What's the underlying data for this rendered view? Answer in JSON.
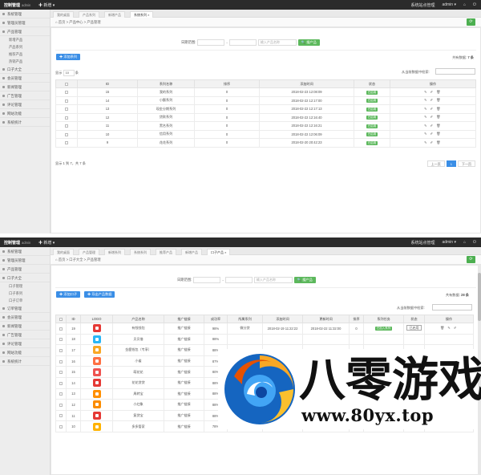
{
  "brand": {
    "name": "控制管理",
    "sub": "admin"
  },
  "topbar": {
    "new_label": "✚ 新增 ▾",
    "site_label": "系统站点管理",
    "user_label": "admin ▾",
    "home_icon": "home-icon",
    "logout_icon": "power-icon"
  },
  "panel1": {
    "sidebar": {
      "items": [
        {
          "label": "系统管理",
          "type": "group"
        },
        {
          "label": "管理员管理",
          "type": "group"
        },
        {
          "label": "产品管理",
          "type": "group"
        },
        {
          "label": "新增产品",
          "type": "sub"
        },
        {
          "label": "产品系列",
          "type": "sub"
        },
        {
          "label": "推荐产品",
          "type": "sub"
        },
        {
          "label": "热销产品",
          "type": "sub"
        },
        {
          "label": "口子大全",
          "type": "group"
        },
        {
          "label": "会员管理",
          "type": "group"
        },
        {
          "label": "新闻管理",
          "type": "group"
        },
        {
          "label": "广告管理",
          "type": "group"
        },
        {
          "label": "评论管理",
          "type": "group"
        },
        {
          "label": "网站功能",
          "type": "group"
        },
        {
          "label": "系统统计",
          "type": "group"
        }
      ]
    },
    "tabs": [
      "我的桌面",
      "产品系列",
      "新增产品",
      "系统系列 ×"
    ],
    "breadcrumb": "⌂ 首页 > 产品中心 > 产品管理",
    "filter": {
      "date_label": "日期范围:",
      "date_placeholder": "",
      "sep": "-",
      "keyword_placeholder": "输入产品名称",
      "search_btn": "🔍 搜产品"
    },
    "add_btn": "✚ 添加系列",
    "count_label": "共有数据:",
    "count_value": "7 条",
    "show_label": "显示",
    "show_value": "10",
    "entries_label": "条",
    "search_label": "从当前数据中检索:",
    "columns": [
      "",
      "ID",
      "系列名称",
      "排序",
      "添加时间",
      "状态",
      "操作"
    ],
    "rows": [
      {
        "id": "15",
        "name": "我的系列",
        "sort": "0",
        "time": "2018-02-23 12:08:09",
        "status": "已启用"
      },
      {
        "id": "14",
        "name": "小额系列",
        "sort": "0",
        "time": "2018-02-22 12:17:00",
        "status": "已启用"
      },
      {
        "id": "13",
        "name": "现金分期系列",
        "sort": "0",
        "time": "2018-02-22 12:17:13",
        "status": "已启用"
      },
      {
        "id": "12",
        "name": "贷款系列",
        "sort": "0",
        "time": "2018-02-22 12:16:40",
        "status": "已启用"
      },
      {
        "id": "11",
        "name": "黑名系列",
        "sort": "0",
        "time": "2018-02-22 12:16:21",
        "status": "已启用"
      },
      {
        "id": "10",
        "name": "信用系列",
        "sort": "0",
        "time": "2018-02-22 12:06:09",
        "status": "已启用"
      },
      {
        "id": "9",
        "name": "花花系列",
        "sort": "0",
        "time": "2018-02-20 20:42:23",
        "status": "已启用"
      }
    ],
    "ops": "✎ ✐ 🗑",
    "footer": "显示 1 到 7，共 7 条",
    "pager": {
      "prev": "上一页",
      "cur": "1",
      "next": "下一页"
    }
  },
  "panel2": {
    "sidebar": {
      "items": [
        {
          "label": "系统管理",
          "type": "group"
        },
        {
          "label": "管理员管理",
          "type": "group"
        },
        {
          "label": "产品管理",
          "type": "group"
        },
        {
          "label": "口子大全",
          "type": "group"
        },
        {
          "label": "口子管理",
          "type": "sub"
        },
        {
          "label": "口子系列",
          "type": "sub"
        },
        {
          "label": "口子订单",
          "type": "sub"
        },
        {
          "label": "订单管理",
          "type": "group"
        },
        {
          "label": "会员管理",
          "type": "group"
        },
        {
          "label": "新闻管理",
          "type": "group"
        },
        {
          "label": "广告管理",
          "type": "group"
        },
        {
          "label": "评论管理",
          "type": "group"
        },
        {
          "label": "网站功能",
          "type": "group"
        },
        {
          "label": "系统统计",
          "type": "group"
        }
      ]
    },
    "tabs": [
      "我的桌面",
      "产品管理",
      "新增系列",
      "系统系列",
      "推荐产品",
      "新增产品",
      "口子产品 ×"
    ],
    "breadcrumb": "⌂ 首页 > 口子大全 > 产品管理",
    "filter": {
      "date_label": "日期范围:",
      "sep": "-",
      "keyword_placeholder": "输入产品名称",
      "search_btn": "🔍 搜产品"
    },
    "add_btn": "✚ 添加口子",
    "export_btn": "✚ 导出产品数据",
    "count_label": "共有数据:",
    "count_value": "28 条",
    "search_label": "从当前数据中检索:",
    "columns": [
      "",
      "ID",
      "LOGO",
      "产品名称",
      "推广链接",
      "成功率",
      "所属系列",
      "添加时间",
      "更新时间",
      "排序",
      "系列任务",
      "状态",
      "操作"
    ],
    "rows": [
      {
        "id": "19",
        "icon": "red-gift",
        "name": "有钱钱包",
        "link": "推广链接",
        "rate": "98%",
        "series": "微分贷",
        "added": "2018-02-19 11:22:22",
        "updated": "2018-02-22 11:32:00",
        "sort": "0",
        "task": "已加入系列",
        "state": "已启用"
      },
      {
        "id": "18",
        "icon": "blue-arrow",
        "name": "贝贝借",
        "link": "推广链接",
        "rate": "88%",
        "series": "",
        "added": "",
        "updated": "",
        "sort": "",
        "task": "",
        "state": ""
      },
      {
        "id": "17",
        "icon": "gold-coin",
        "name": "金鹿钱包（专享）",
        "link": "推广链接",
        "rate": "88%",
        "series": "",
        "added": "",
        "updated": "",
        "sort": "",
        "task": "",
        "state": ""
      },
      {
        "id": "16",
        "icon": "orange-bag",
        "name": "小雀",
        "link": "推广链接",
        "rate": "87%",
        "series": "",
        "added": "",
        "updated": "",
        "sort": "",
        "task": "",
        "state": ""
      },
      {
        "id": "15",
        "icon": "red-clock",
        "name": "萌花花",
        "link": "推广链接",
        "rate": "80%",
        "series": "",
        "added": "",
        "updated": "",
        "sort": "",
        "task": "",
        "state": ""
      },
      {
        "id": "14",
        "icon": "red-flower",
        "name": "花花贷贷",
        "link": "推广链接",
        "rate": "88%",
        "series": "",
        "added": "",
        "updated": "",
        "sort": "",
        "task": "",
        "state": ""
      },
      {
        "id": "13",
        "icon": "orange-card",
        "name": "周转宝",
        "link": "推广链接",
        "rate": "88%",
        "series": "",
        "added": "",
        "updated": "",
        "sort": "",
        "task": "",
        "state": ""
      },
      {
        "id": "12",
        "icon": "orange-wallet",
        "name": "小红象",
        "link": "推广链接",
        "rate": "88%",
        "series": "",
        "added": "",
        "updated": "",
        "sort": "",
        "task": "",
        "state": ""
      },
      {
        "id": "11",
        "icon": "red-play",
        "name": "复贷宝",
        "link": "推广链接",
        "rate": "88%",
        "series": "",
        "added": "",
        "updated": "",
        "sort": "",
        "task": "",
        "state": ""
      },
      {
        "id": "10",
        "icon": "orange-bulb",
        "name": "多多管家",
        "link": "推广链接",
        "rate": "78%",
        "series": "微分贷",
        "added": "2018-02-19 10:48:42",
        "updated": "2018-02-22 12:13:29",
        "sort": "0",
        "task": "已加入系列",
        "state": ""
      }
    ],
    "ops": "🗑 ✎ ✐"
  },
  "watermark": {
    "big": "八零游戏",
    "url": "www.80yx.top",
    "logo_icon": "swirl-logo-icon"
  },
  "colors": {
    "topbar": "#2b2b2b",
    "accent_green": "#5cb85c",
    "accent_blue": "#3a8ee6",
    "sidebar": "#ededed"
  }
}
